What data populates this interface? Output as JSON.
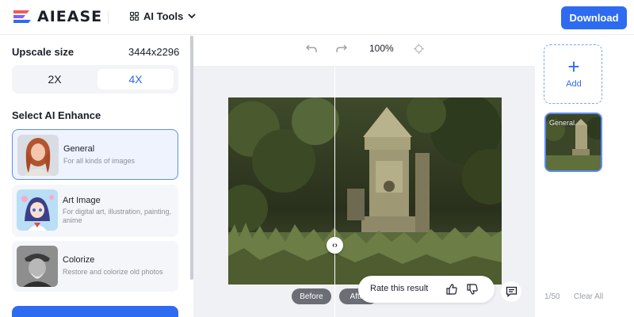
{
  "header": {
    "brand": "AIEASE",
    "ai_tools_label": "AI Tools",
    "download_label": "Download"
  },
  "sidebar": {
    "upscale_label": "Upscale size",
    "upscale_value": "3444x2296",
    "scale_options": [
      "2X",
      "4X"
    ],
    "selected_scale": "4X",
    "enhance_label": "Select AI Enhance",
    "enhance_options": [
      {
        "title": "General",
        "desc": "For all kinds of images",
        "selected": true
      },
      {
        "title": "Art Image",
        "desc": "For digital art, illustration, painting, anime",
        "selected": false
      },
      {
        "title": "Colorize",
        "desc": "Restore and colorize old photos",
        "selected": false
      }
    ]
  },
  "canvas": {
    "zoom": "100%",
    "before_label": "Before",
    "after_label": "After",
    "rate_label": "Rate this result"
  },
  "right_panel": {
    "add_label": "Add",
    "thumb_label": "General",
    "count": "1/50",
    "clear_label": "Clear All"
  },
  "colors": {
    "accent": "#2e6bf0",
    "selected_border": "#5b8ef5"
  },
  "icons": [
    "ai-tools-grid-icon",
    "chevron-down-icon",
    "undo-icon",
    "redo-icon",
    "locate-icon",
    "split-handle-icon",
    "thumbs-up-icon",
    "thumbs-down-icon",
    "comment-icon",
    "plus-icon"
  ]
}
